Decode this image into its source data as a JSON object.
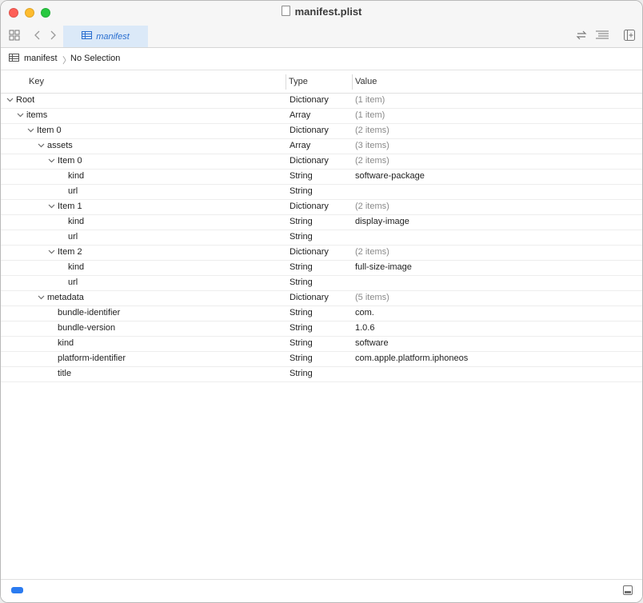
{
  "window": {
    "title": "manifest.plist"
  },
  "toolbar": {
    "tab_label": "manifest",
    "icons": [
      "grid-icon",
      "back-icon",
      "forward-icon",
      "swap-icon",
      "lines-icon",
      "add-panel-icon"
    ]
  },
  "jumpbar": {
    "file": "manifest",
    "selection": "No Selection"
  },
  "columns": {
    "key": "Key",
    "type": "Type",
    "value": "Value"
  },
  "rows": [
    {
      "key": "Root",
      "type": "Dictionary",
      "value": "(1 item)",
      "summary": true,
      "level": 0,
      "expandable": true
    },
    {
      "key": "items",
      "type": "Array",
      "value": "(1 item)",
      "summary": true,
      "level": 1,
      "expandable": true
    },
    {
      "key": "Item 0",
      "type": "Dictionary",
      "value": "(2 items)",
      "summary": true,
      "level": 2,
      "expandable": true
    },
    {
      "key": "assets",
      "type": "Array",
      "value": "(3 items)",
      "summary": true,
      "level": 3,
      "expandable": true
    },
    {
      "key": "Item 0",
      "type": "Dictionary",
      "value": "(2 items)",
      "summary": true,
      "level": 4,
      "expandable": true
    },
    {
      "key": "kind",
      "type": "String",
      "value": "software-package",
      "summary": false,
      "level": 5,
      "expandable": false
    },
    {
      "key": "url",
      "type": "String",
      "value": "",
      "summary": false,
      "level": 5,
      "expandable": false
    },
    {
      "key": "Item 1",
      "type": "Dictionary",
      "value": "(2 items)",
      "summary": true,
      "level": 4,
      "expandable": true
    },
    {
      "key": "kind",
      "type": "String",
      "value": "display-image",
      "summary": false,
      "level": 5,
      "expandable": false
    },
    {
      "key": "url",
      "type": "String",
      "value": "",
      "summary": false,
      "level": 5,
      "expandable": false
    },
    {
      "key": "Item 2",
      "type": "Dictionary",
      "value": "(2 items)",
      "summary": true,
      "level": 4,
      "expandable": true
    },
    {
      "key": "kind",
      "type": "String",
      "value": "full-size-image",
      "summary": false,
      "level": 5,
      "expandable": false
    },
    {
      "key": "url",
      "type": "String",
      "value": "",
      "summary": false,
      "level": 5,
      "expandable": false
    },
    {
      "key": "metadata",
      "type": "Dictionary",
      "value": "(5 items)",
      "summary": true,
      "level": 3,
      "expandable": true
    },
    {
      "key": "bundle-identifier",
      "type": "String",
      "value": "com.",
      "summary": false,
      "level": 4,
      "expandable": false
    },
    {
      "key": "bundle-version",
      "type": "String",
      "value": "1.0.6",
      "summary": false,
      "level": 4,
      "expandable": false
    },
    {
      "key": "kind",
      "type": "String",
      "value": "software",
      "summary": false,
      "level": 4,
      "expandable": false
    },
    {
      "key": "platform-identifier",
      "type": "String",
      "value": "com.apple.platform.iphoneos",
      "summary": false,
      "level": 4,
      "expandable": false
    },
    {
      "key": "title",
      "type": "String",
      "value": "",
      "summary": false,
      "level": 4,
      "expandable": false
    }
  ],
  "colors": {
    "accent": "#2b7bf0",
    "tab_bg": "#dbe9f8",
    "summary_text": "#8a8a8a"
  }
}
